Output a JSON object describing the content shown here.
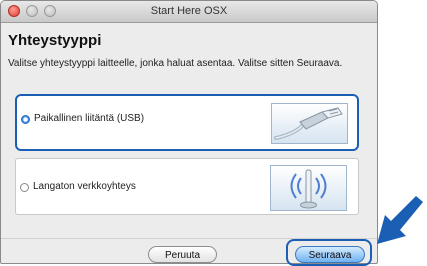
{
  "window": {
    "title": "Start Here OSX"
  },
  "page": {
    "heading": "Yhteystyyppi",
    "instruction": "Valitse yhteystyyppi laitteelle, jonka haluat asentaa. Valitse sitten Seuraava."
  },
  "options": [
    {
      "label": "Paikallinen liitäntä (USB)",
      "selected": true,
      "icon": "usb-cable-icon"
    },
    {
      "label": "Langaton verkkoyhteys",
      "selected": false,
      "icon": "wireless-signal-icon"
    }
  ],
  "buttons": {
    "cancel": "Peruuta",
    "next": "Seuraava"
  },
  "colors": {
    "highlight": "#1a5fb4",
    "arrow": "#1a5fb4"
  }
}
